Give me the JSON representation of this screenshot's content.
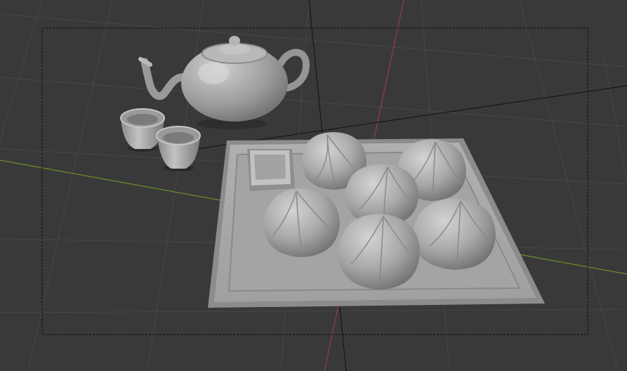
{
  "viewport": {
    "background": "#393939",
    "grid_color": "#474747",
    "x_axis_color": "#9b3a44",
    "y_axis_color": "#6a8f2a",
    "camera_frame_color": "#0b0b0b",
    "mesh_color": "#a9a9a9"
  },
  "scene_objects": [
    {
      "name": "teapot"
    },
    {
      "name": "teacup"
    },
    {
      "name": "teacup"
    },
    {
      "name": "tray"
    },
    {
      "name": "sauce-dish"
    },
    {
      "name": "bun"
    },
    {
      "name": "bun"
    },
    {
      "name": "bun"
    },
    {
      "name": "bun"
    },
    {
      "name": "bun"
    },
    {
      "name": "bun"
    }
  ]
}
